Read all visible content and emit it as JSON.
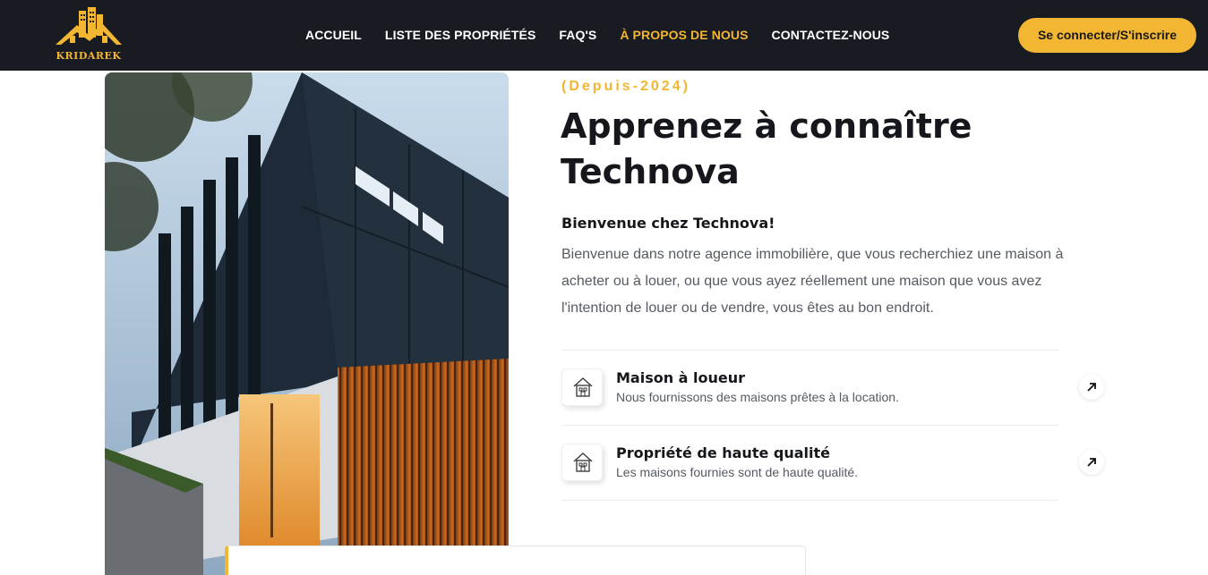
{
  "header": {
    "logo_text": "KRIDAREK",
    "nav": [
      {
        "label": "ACCUEIL",
        "active": false
      },
      {
        "label": "LISTE DES PROPRIÉTÉS",
        "active": false
      },
      {
        "label": "FAQ'S",
        "active": false
      },
      {
        "label": "À PROPOS DE NOUS",
        "active": true
      },
      {
        "label": "CONTACTEZ-NOUS",
        "active": false
      }
    ],
    "login_label": "Se connecter/S'inscrire"
  },
  "about": {
    "since": "(Depuis-2024)",
    "title": "Apprenez à connaître Technova",
    "welcome": "Bienvenue chez Technova!",
    "description": "Bienvenue dans notre agence immobilière, que vous recherchiez une maison à acheter ou à louer, ou que vous ayez réellement une maison que vous avez l'intention de louer ou de vendre, vous êtes au bon endroit.",
    "features": [
      {
        "title": "Maison à loueur",
        "subtitle": "Nous fournissons des maisons prêtes à la location.",
        "icon": "house-icon"
      },
      {
        "title": "Propriété de haute qualité",
        "subtitle": "Les maisons fournies sont de haute qualité.",
        "icon": "house-icon"
      }
    ]
  },
  "colors": {
    "header_bg": "#181b22",
    "accent": "#f2b632",
    "text_dark": "#15171c",
    "text_muted": "#555a63"
  }
}
